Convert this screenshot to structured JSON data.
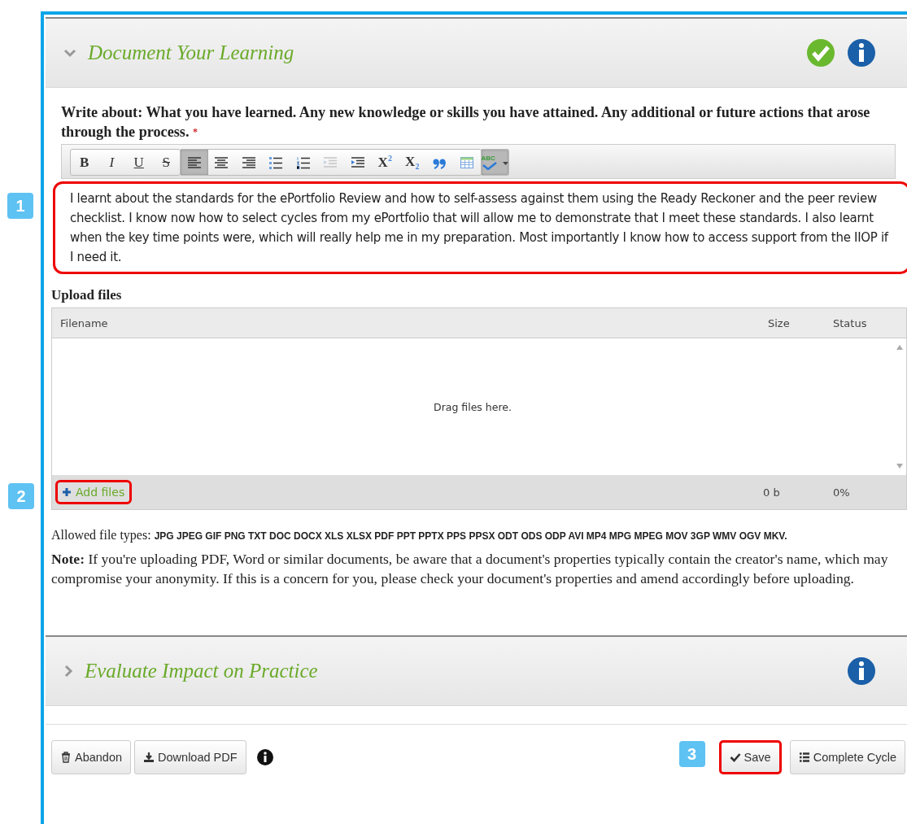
{
  "section_1": {
    "title": "Document Your Learning",
    "expanded": true,
    "complete": true
  },
  "prompt": {
    "text": "Write about: What you have learned. Any new knowledge or skills you have attained. Any additional or future actions that arose through the process.",
    "required_mark": "*"
  },
  "toolbar_groups": [
    {
      "buttons": [
        {
          "kind": "bold",
          "label": "B",
          "selected": false,
          "disabled": false
        },
        {
          "kind": "italic",
          "label": "I",
          "selected": false,
          "disabled": false
        },
        {
          "kind": "underline",
          "label": "U",
          "selected": false,
          "disabled": false
        },
        {
          "kind": "strike",
          "label": "S",
          "selected": false,
          "disabled": false
        }
      ]
    },
    {
      "buttons": [
        {
          "kind": "align-left",
          "selected": true,
          "disabled": false
        },
        {
          "kind": "align-center",
          "selected": false,
          "disabled": false
        },
        {
          "kind": "align-right",
          "selected": false,
          "disabled": false
        },
        {
          "kind": "bullets",
          "selected": false,
          "disabled": false
        },
        {
          "kind": "numbers",
          "selected": false,
          "disabled": false
        },
        {
          "kind": "outdent",
          "selected": false,
          "disabled": true
        },
        {
          "kind": "indent",
          "selected": false,
          "disabled": false
        },
        {
          "kind": "superscript",
          "label": "X$^{2}$",
          "selected": false,
          "disabled": false
        },
        {
          "kind": "subscript",
          "label": "X$_{2}$",
          "selected": false,
          "disabled": false
        },
        {
          "kind": "quote",
          "selected": false,
          "disabled": false
        },
        {
          "kind": "table",
          "selected": false,
          "disabled": false
        }
      ]
    },
    {
      "buttons": [
        {
          "kind": "spellcheck",
          "label": "ABC",
          "selected": true,
          "disabled": false
        }
      ]
    }
  ],
  "editor": {
    "value": "I learnt about the standards for the ePortfolio Review and how to self-assess against them using the Ready Reckoner and the peer review checklist. I know now how to select cycles from my ePortfolio that will allow me to demonstrate that I meet these standards. I also learnt when the key time points were, which will really help me in my preparation. Most importantly I know how to access support from the IIOP if I need it.",
    "highlighted": true,
    "callout": "1"
  },
  "upload": {
    "heading": "Upload files",
    "columns": [
      "Filename",
      "Size",
      "Status"
    ],
    "drop_hint": "Drag files here.",
    "add_button": {
      "label": "Add files",
      "highlighted": true,
      "callout": "2"
    },
    "total_size": "0 b",
    "total_status": "0%"
  },
  "allowed": {
    "label": "Allowed file types:",
    "types": "JPG JPEG GIF PNG TXT DOC DOCX XLS XLSX PDF PPT PPTX PPS PPSX ODT ODS ODP AVI MP4 MPG MPEG MOV 3GP WMV OGV MKV."
  },
  "note": "**Note:** If you're uploading PDF, Word or similar documents, be aware that a document's properties typically contain the creator's name, which may compromise your anonymity. If this is a concern for you, please check your document's properties and amend accordingly before uploading.",
  "section_2": {
    "title": "Evaluate Impact on Practice",
    "expanded": false,
    "complete": false
  },
  "footer": {
    "left": [
      {
        "kind": "trash",
        "label": "Abandon"
      },
      {
        "kind": "download",
        "label": "Download PDF"
      }
    ],
    "right": [
      {
        "kind": "check",
        "label": "Save",
        "highlighted": true,
        "callout": "3"
      },
      {
        "kind": "list",
        "label": "Complete Cycle",
        "highlighted": false
      }
    ]
  }
}
